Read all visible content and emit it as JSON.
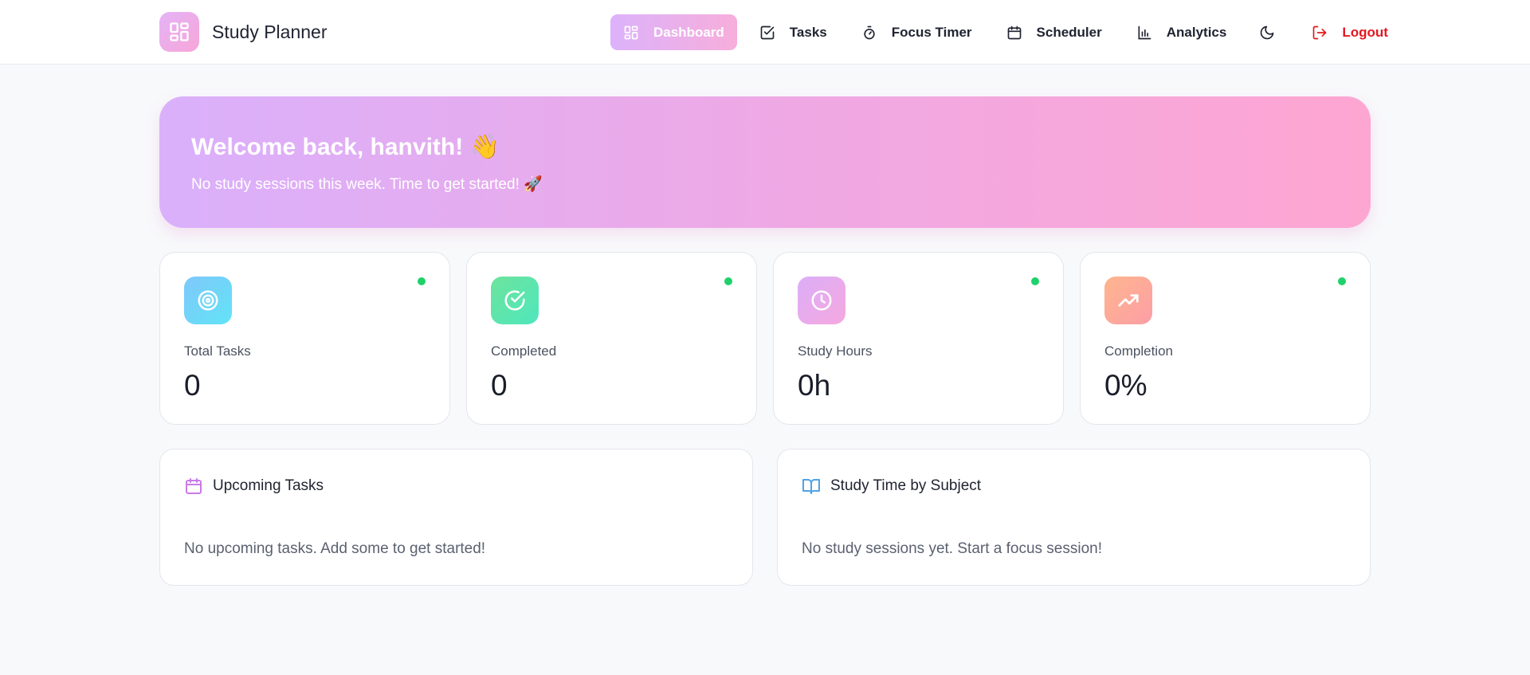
{
  "app": {
    "title": "Study Planner",
    "accent_gradient_start": "#dcb2fb",
    "accent_gradient_end": "#f7aedb"
  },
  "nav": {
    "items": [
      {
        "label": "Dashboard",
        "icon": "grid-icon",
        "active": true
      },
      {
        "label": "Tasks",
        "icon": "checkbox-icon"
      },
      {
        "label": "Focus Timer",
        "icon": "stopwatch-icon"
      },
      {
        "label": "Scheduler",
        "icon": "calendar-icon"
      },
      {
        "label": "Analytics",
        "icon": "bar-chart-icon"
      }
    ],
    "theme_toggle_icon": "moon-icon",
    "logout_label": "Logout",
    "logout_color": "#e4181f"
  },
  "hero": {
    "title": "Welcome back, hanvith! 👋",
    "subtitle": "No study sessions this week. Time to get started! 🚀"
  },
  "stats": [
    {
      "label": "Total Tasks",
      "value": "0",
      "icon": "target-icon",
      "color": "#5ad4f8"
    },
    {
      "label": "Completed",
      "value": "0",
      "icon": "check-circle-icon",
      "color": "#4fe29b"
    },
    {
      "label": "Study Hours",
      "value": "0h",
      "icon": "clock-icon",
      "color": "#e9a8f2"
    },
    {
      "label": "Completion",
      "value": "0%",
      "icon": "trending-up-icon",
      "color": "#fe9f8f"
    }
  ],
  "panels": {
    "upcoming": {
      "title": "Upcoming Tasks",
      "empty": "No upcoming tasks. Add some to get started!",
      "icon": "calendar-icon"
    },
    "subjects": {
      "title": "Study Time by Subject",
      "empty": "No study sessions yet. Start a focus session!",
      "icon": "book-open-icon"
    }
  }
}
